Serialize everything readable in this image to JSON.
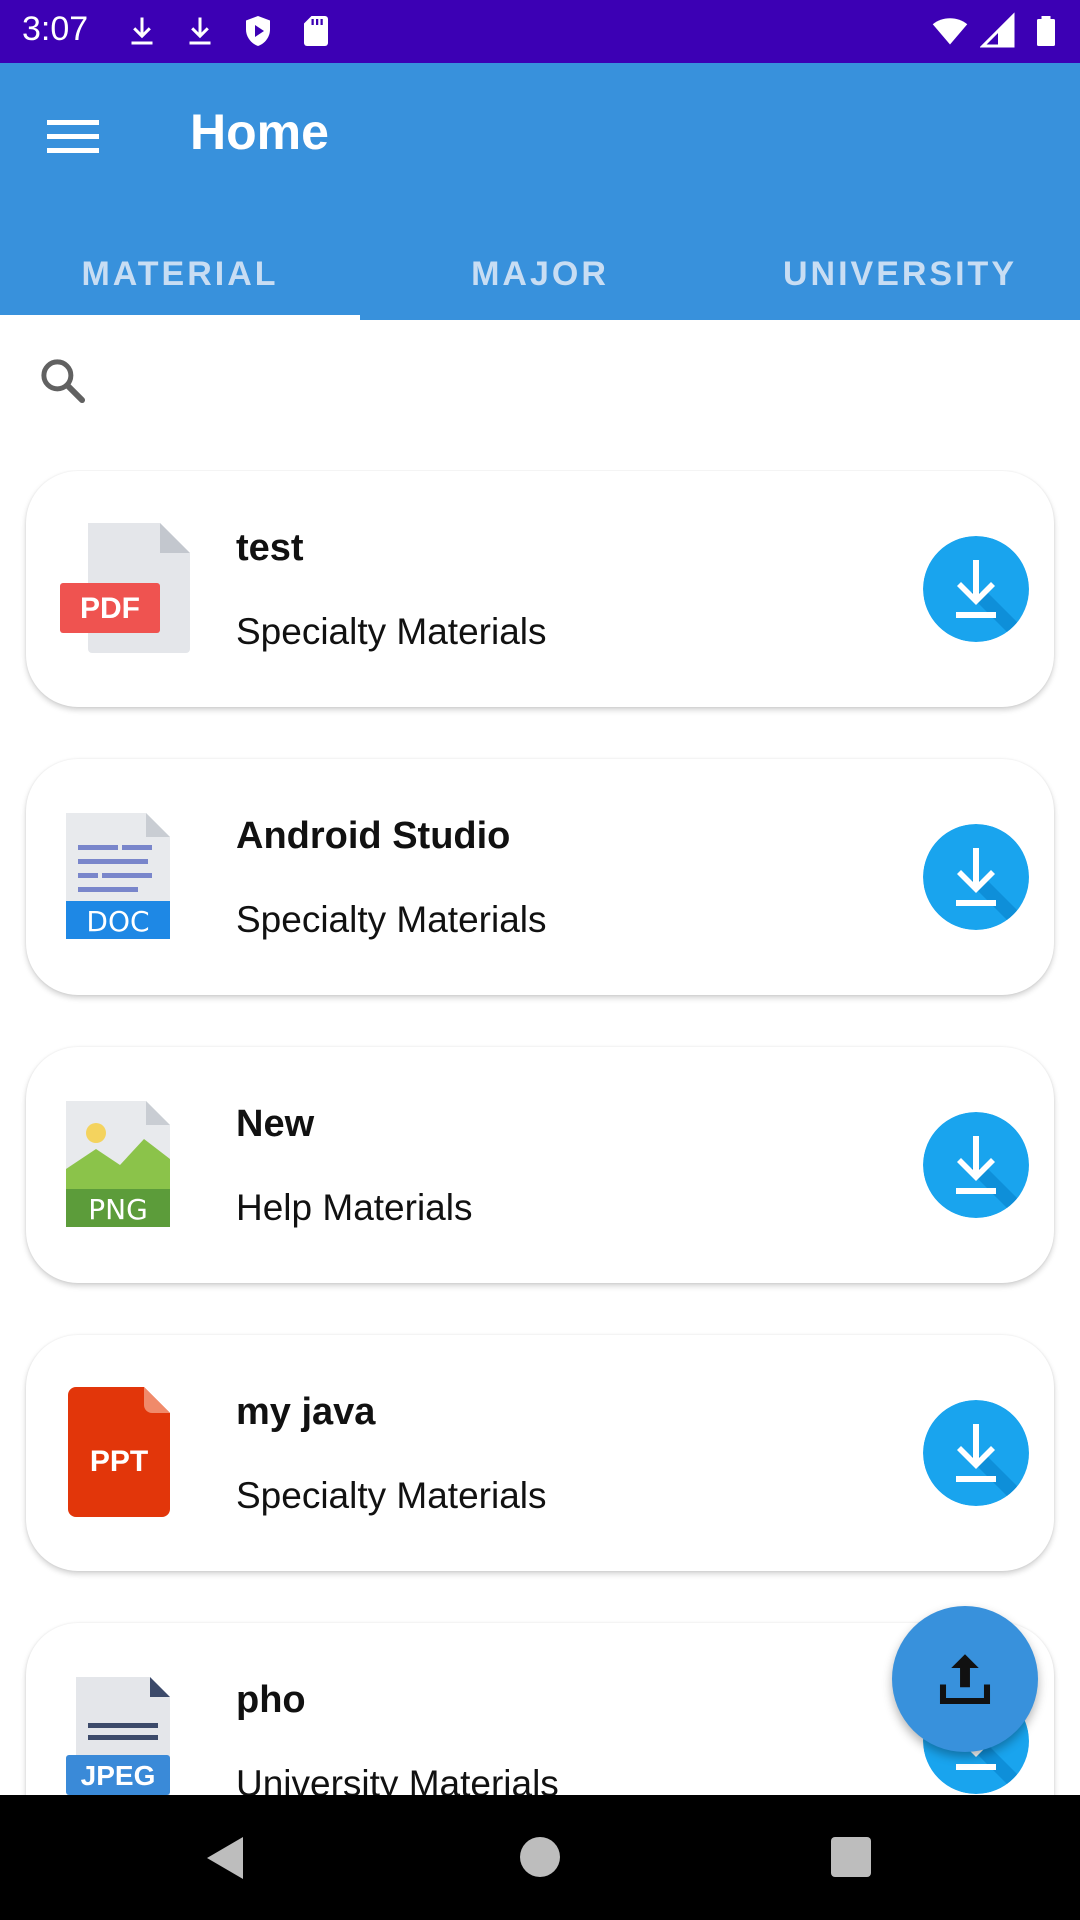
{
  "status_bar": {
    "time": "3:07",
    "left_icons": [
      "download-icon",
      "download-icon",
      "shield-icon",
      "sd-card-icon"
    ],
    "right_icons": [
      "wifi-icon",
      "signal-icon",
      "battery-icon"
    ]
  },
  "app_bar": {
    "title": "Home",
    "menu_icon": "menu-icon"
  },
  "tabs": [
    {
      "label": "MATERIAL",
      "active": true
    },
    {
      "label": "MAJOR",
      "active": false
    },
    {
      "label": "UNIVERSITY",
      "active": false
    }
  ],
  "search": {
    "placeholder": "",
    "value": ""
  },
  "items": [
    {
      "title": "test",
      "subtitle": "Specialty Materials",
      "type_label": "PDF",
      "type_color": "#ef5350"
    },
    {
      "title": "Android Studio",
      "subtitle": "Specialty Materials",
      "type_label": "DOC",
      "type_color": "#1e88e5"
    },
    {
      "title": "New",
      "subtitle": "Help Materials",
      "type_label": "PNG",
      "type_color": "#5c9c3a"
    },
    {
      "title": "my java",
      "subtitle": "Specialty Materials",
      "type_label": "PPT",
      "type_color": "#e2360a"
    },
    {
      "title": "pho",
      "subtitle": "University Materials",
      "type_label": "JPEG",
      "type_color": "#3a8ad8"
    }
  ],
  "colors": {
    "status_bar": "#3c00b4",
    "app_bar": "#3891dc",
    "download_button": "#19a4ee"
  },
  "fab": {
    "icon": "upload-icon"
  }
}
